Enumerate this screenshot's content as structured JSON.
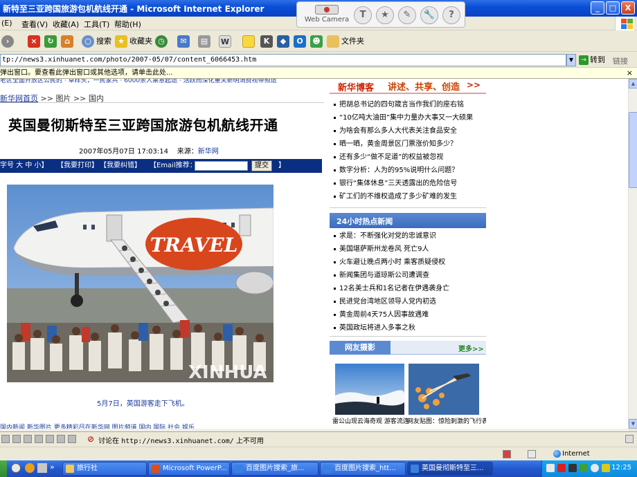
{
  "window": {
    "title": "新特至三亚跨国旅游包机航线开通 - Microsoft Internet Explorer",
    "controls": {
      "minimize": "_",
      "maximize": "□",
      "close": "X"
    }
  },
  "webcam_toolbar": {
    "label": "Web Camera",
    "icons": [
      "T",
      "★",
      "✎",
      "🔧",
      "?"
    ]
  },
  "menu": [
    "(E)",
    "查看(V)",
    "收藏(A)",
    "工具(T)",
    "帮助(H)"
  ],
  "toolbar": {
    "search_label": "搜索",
    "favorites_label": "收藏夹",
    "folders_label": "文件夹"
  },
  "address": {
    "url": "tp://news3.xinhuanet.com/photo/2007-05/07/content_6066453.htm",
    "go_label": "转到",
    "links_label": "链接"
  },
  "infobar": {
    "text": "弹出窗口。要查看此弹出窗口或其他选项，请单击此处...",
    "close": "×"
  },
  "page": {
    "ticker": "老区全面开放区公民的 · 草样头，一民家共 · 6000余人乘意起运 · 活跃而深化重关新明消费视带频运",
    "breadcrumb": {
      "home": "新华网首页",
      "sep1": ">>",
      "section": "图片",
      "sep2": ">>",
      "sub": "国内"
    },
    "headline": "英国曼彻斯特至三亚跨国旅游包机航线开通",
    "meta": {
      "datetime": "2007年05月07日 17:03:14",
      "source_label": "来源：",
      "source": "新华网"
    },
    "tools": {
      "fontsize": "字号 大 中 小】",
      "print": "【我要打印】",
      "correct": "【我要纠错】",
      "email_label": "【Email推荐：",
      "submit": "提交",
      "end": "】"
    },
    "photo": {
      "plane_text": "TRAVEL",
      "watermark": "XINHUA"
    },
    "caption": "5月7日，英国游客走下飞机。",
    "bottom_fade": "国内新闻  新华图片  更多精彩尽在新华网  图片频道  国内  国际  社会  娱乐"
  },
  "sidebar": {
    "blog": {
      "name": "新华博客",
      "slogan": "讲述、共享、创造",
      "more": ">>",
      "items": [
        "把胡总书记的四句箴言当作我们的座右铭",
        "“10亿吨大油田”集中力量办大事又一大硕果",
        "为啥会有那么多人大代表关注食品安全",
        "晒一晒，黄金周景区门票涨价知多少？",
        "还有多少“做不足道”的权益被忽视",
        "数字分析：人为的95%说明什么问题？",
        "银行“集体休息”三天透露出的危险信号",
        "矿工们的不维权造成了多少矿难的发生"
      ]
    },
    "hot": {
      "title": "24小时热点新闻",
      "items": [
        "求是：不断强化对党的忠诚意识",
        "美国堪萨斯州龙卷风 死亡9人",
        "火车避让晚点两小时 乘客质疑侵权",
        "新闻集团与道琼斯公司遭调查",
        "12名美士兵和1名记者在伊遇袭身亡",
        "民进党台湾地区领导人党内初选",
        "黄金周前4天75人因事故遇难",
        "英国政坛将进入多事之秋"
      ]
    },
    "photos": {
      "title": "网友摄影",
      "more": "更多>>",
      "captions": [
        "雷公山现云海奇观 游客流连忘返(组图)",
        "网友贴图：惊险刺激的飞行表演(组图)"
      ]
    }
  },
  "status": {
    "prefix": "讨论在",
    "url": "http://news3.xinhuanet.com/",
    "suffix": "上不可用"
  },
  "zone": {
    "label": "Internet"
  },
  "taskbar": {
    "tasks": [
      "旅行社",
      "Microsoft PowerP...",
      "百度图片搜索_旅...",
      "百度图片搜索_htt...",
      "英国曼彻斯特至三..."
    ],
    "clock": "12:25"
  },
  "colors": {
    "title_blue": "#0a4fd6",
    "link_blue": "#1a3a9a",
    "nav_dark": "#0a2e82",
    "blog_red": "#cc2200",
    "hot_blue": "#3a6cc0"
  }
}
